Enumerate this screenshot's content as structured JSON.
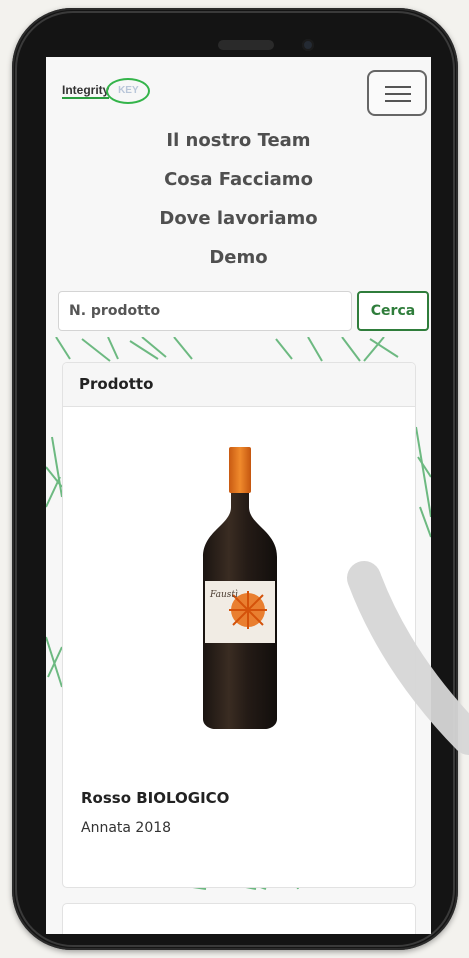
{
  "brand": {
    "name": "Integrity",
    "suffix": "KEY"
  },
  "nav": {
    "menu_icon": "hamburger-menu-icon",
    "links": [
      "Il nostro Team",
      "Cosa Facciamo",
      "Dove lavoriamo",
      "Demo"
    ]
  },
  "search": {
    "placeholder": "N. prodotto",
    "button": "Cerca"
  },
  "card": {
    "header": "Prodotto",
    "bottle_label": "Faustì",
    "name": "Rosso BIOLOGICO",
    "year": "Annata 2018"
  },
  "colors": {
    "accent": "#2f7d3b",
    "brand_green": "#34b44a",
    "bottle_cap": "#e8731c"
  }
}
